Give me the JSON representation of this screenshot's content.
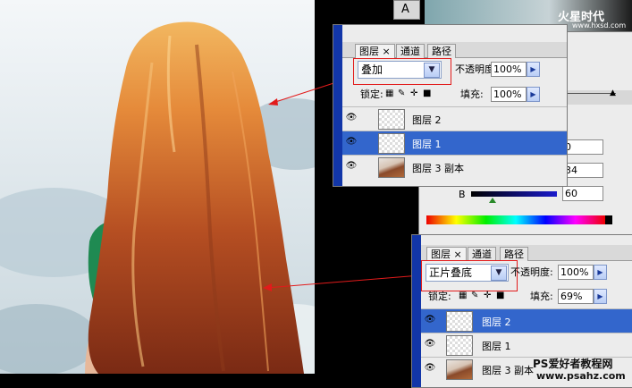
{
  "top_panel": {
    "tabs": [
      "图层",
      "通道",
      "路径"
    ],
    "blend_mode": "叠加",
    "opacity_label": "不透明度:",
    "opacity_value": "100%",
    "lock_label": "锁定:",
    "fill_label": "填充:",
    "fill_value": "100%",
    "layers": [
      {
        "name": "图层 2",
        "selected": false,
        "thumb": "transparent"
      },
      {
        "name": "图层 1",
        "selected": true,
        "thumb": "transparent"
      },
      {
        "name": "图层 3 副本",
        "selected": false,
        "thumb": "hair"
      }
    ]
  },
  "bottom_panel": {
    "tabs": [
      "图层",
      "通道",
      "路径"
    ],
    "blend_mode": "正片叠底",
    "opacity_label": "不透明度:",
    "opacity_value": "100%",
    "lock_label": "锁定:",
    "fill_label": "填充:",
    "fill_value": "69%",
    "layers": [
      {
        "name": "图层 2",
        "selected": true,
        "thumb": "transparent"
      },
      {
        "name": "图层 1",
        "selected": false,
        "thumb": "transparent"
      },
      {
        "name": "图层 3 副本",
        "selected": false,
        "thumb": "hair"
      }
    ]
  },
  "color_panel": {
    "values": [
      "0",
      "34",
      "60"
    ],
    "b_label": "B"
  },
  "toolbar": {
    "text_tool_label": "A"
  },
  "watermarks": {
    "top_logo": "火星时代",
    "top_url": "www.hxsd.com",
    "bottom_title": "PS爱好者教程网",
    "bottom_url": "www.psahz.com"
  },
  "colors": {
    "selection": "#3366cc",
    "annotation_red": "#e21b1b",
    "border_blue": "#1236a8"
  }
}
